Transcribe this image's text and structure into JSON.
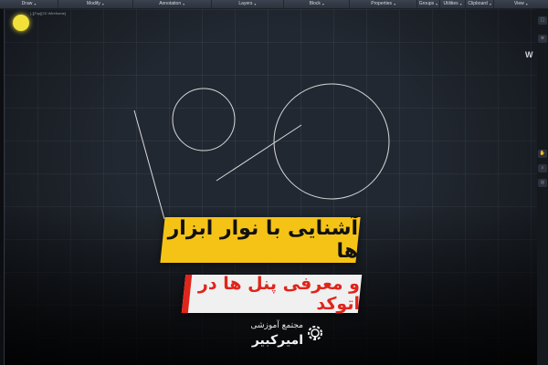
{
  "ribbon": {
    "panels": [
      {
        "label": "Draw",
        "w": 64
      },
      {
        "label": "Modify",
        "w": 82
      },
      {
        "label": "Annotation",
        "w": 86
      },
      {
        "label": "Layers",
        "w": 80
      },
      {
        "label": "Block",
        "w": 72
      },
      {
        "label": "Properties",
        "w": 74
      },
      {
        "label": "Groups",
        "w": 24
      },
      {
        "label": "Utilities",
        "w": 28
      },
      {
        "label": "Clipboard",
        "w": 30
      },
      {
        "label": "View",
        "w": 40
      }
    ]
  },
  "viewport": {
    "label": "[-][Top][2D Wireframe]",
    "viewcube_letter": "W"
  },
  "banners": {
    "title": "آشنایی با نوار ابزار ها",
    "subtitle": "و معرفی پنل ها در اتوکد"
  },
  "logo": {
    "line1": "مجتمع آموزشی",
    "line2": "امیرکبیر"
  },
  "colors": {
    "banner_yellow": "#f5c316",
    "banner_red": "#e0251b",
    "cursor": "#f2e13a"
  }
}
